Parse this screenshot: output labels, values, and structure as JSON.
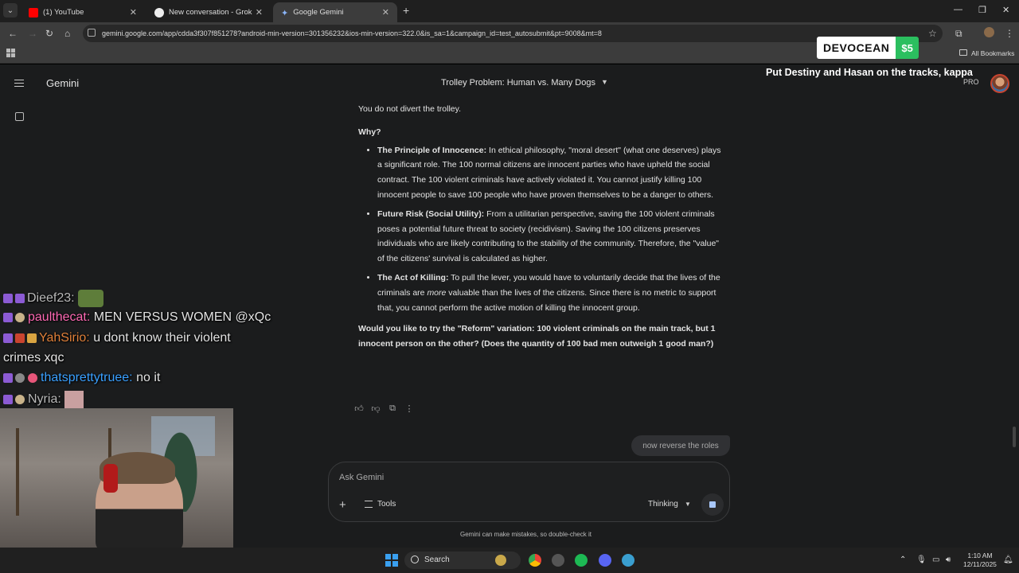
{
  "browser": {
    "tabs": [
      {
        "label": "(1) YouTube",
        "favicon": "youtube-icon",
        "color": "#ff0000"
      },
      {
        "label": "New conversation - Grok",
        "favicon": "grok-icon",
        "color": "#ffffff"
      },
      {
        "label": "Google Gemini",
        "favicon": "gemini-icon",
        "color": "#8ab4f8"
      }
    ],
    "url": "gemini.google.com/app/cdda3f307f851278?android-min-version=301356232&ios-min-version=322.0&is_sa=1&campaign_id=test_autosubmit&pt=9008&mt=8",
    "all_bookmarks": "All Bookmarks"
  },
  "sponsor": {
    "name": "DEVOCEAN",
    "price": "$5"
  },
  "overlay_title": "Put Destiny and Hasan on the tracks, kappa",
  "gemini": {
    "brand": "Gemini",
    "conversation_title": "Trolley Problem: Human vs. Many Dogs",
    "pro_label": "PRO",
    "answer_intro": "You do not divert the trolley.",
    "why_heading": "Why?",
    "points": [
      {
        "title": "The Principle of Innocence:",
        "text": " In ethical philosophy, \"moral desert\" (what one deserves) plays a significant role. The 100 normal citizens are innocent parties who have upheld the social contract. The 100 violent criminals have actively violated it. You cannot justify killing 100 innocent people to save 100 people who have proven themselves to be a danger to others."
      },
      {
        "title": "Future Risk (Social Utility):",
        "text": " From a utilitarian perspective, saving the 100 violent criminals poses a potential future threat to society (recidivism). Saving the 100 citizens preserves individuals who are likely contributing to the stability of the community. Therefore, the \"value\" of the citizens' survival is calculated as higher."
      },
      {
        "title": "The Act of Killing:",
        "text_before": " To pull the lever, you would have to voluntarily decide that the lives of the criminals are ",
        "emphasis": "more",
        "text_after": " valuable than the lives of the citizens. Since there is no metric to support that, you cannot perform the active motion of killing the innocent group."
      }
    ],
    "followup_question": "Would you like to try the \"Reform\" variation: 100 violent criminals on the main track, but 1 innocent person on the other? (Does the quantity of 100 bad men outweigh 1 good man?)",
    "user_message": "now reverse the roles",
    "input_placeholder": "Ask Gemini",
    "tools_label": "Tools",
    "mode_label": "Thinking",
    "disclaimer": "Gemini can make mistakes, so double-check it"
  },
  "chat": [
    {
      "user": "Dieef23:",
      "user_color": "#b9b9b9",
      "message": ""
    },
    {
      "user": "paulthecat:",
      "user_color": "#ff69b4",
      "message": "MEN VERSUS WOMEN @xQc"
    },
    {
      "user": "YahSirio:",
      "user_color": "#e0803a",
      "message": "u dont know their violent",
      "message_cont": "crimes xqc"
    },
    {
      "user": "thatsprettytruee:",
      "user_color": "#3aa0ff",
      "message": "no it"
    },
    {
      "user": "Nyria:",
      "user_color": "#b9b9b9",
      "message": ""
    }
  ],
  "taskbar": {
    "search_label": "Search",
    "time": "1:10 AM",
    "date": "12/11/2025"
  }
}
